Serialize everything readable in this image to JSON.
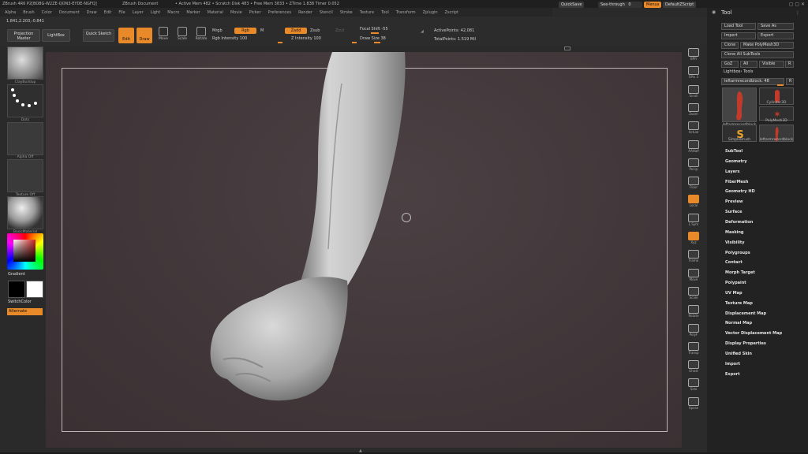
{
  "titlebar": {
    "app": "ZBrush 4R6 P2[BO8G-W2ZE-QON3-EYDE-NGFQ]",
    "document": "ZBrush Document",
    "stats": "• Active Mem 482 • Scratch Disk 483 • Free Mem 3833 • ZTime 1.838 Timer 0.052"
  },
  "menubar": [
    "Alpha",
    "Brush",
    "Color",
    "Document",
    "Draw",
    "Edit",
    "File",
    "Layer",
    "Light",
    "Macro",
    "Marker",
    "Material",
    "Movie",
    "Picker",
    "Preferences",
    "Render",
    "Stencil",
    "Stroke",
    "Texture",
    "Tool",
    "Transform",
    "Zplugin",
    "Zscript"
  ],
  "topright": {
    "quicksave": "QuickSave",
    "seethrough": "See-through",
    "seethrough_value": "0",
    "menus": "Menus",
    "defaultscript": "DefaultZScript"
  },
  "toolbar": {
    "coords": "1.841,2.203,-0.841",
    "projection_master": "Projection Master",
    "lightbox": "LightBox",
    "quick_sketch": "Quick Sketch",
    "edit": "Edit",
    "draw": "Draw",
    "move": "Move",
    "scale": "Scale",
    "rotate": "Rotate",
    "mrgb": "Mrgb",
    "rgb": "Rgb",
    "m": "M",
    "zadd": "Zadd",
    "zsub": "Zsub",
    "zcut": "Zcut",
    "rgb_intensity": "Rgb Intensity 100",
    "z_intensity": "Z Intensity 100",
    "focal_shift": "Focal Shift -55",
    "draw_size": "Draw Size 38",
    "active_points": "ActivePoints: 42,081",
    "total_points": "TotalPoints: 1.519 Mil"
  },
  "leftshelf": {
    "brush_label": "ClayBuildup",
    "stroke_label": "Dots",
    "alpha_label": "Alpha Off",
    "texture_label": "Texture Off",
    "material_label": "BasicMaterial",
    "gradient": "Gradient",
    "switch_color": "SwitchColor",
    "alternate": "Alternate"
  },
  "rightshelf": [
    "BPR",
    "SPix 3",
    "Scroll",
    "Zoom",
    "Actual",
    "AAHalf",
    "Persp",
    "Floor",
    "Local",
    "L.Sym",
    "Xyz",
    "Frame",
    "Move",
    "Scale",
    "Rotate",
    "PolyF",
    "Transp",
    "Ghost",
    "Solo",
    "Xpose"
  ],
  "palette": {
    "title": "Tool",
    "load_tool": "Load Tool",
    "save_as": "Save As",
    "import": "Import",
    "export": "Export",
    "clone": "Clone",
    "make_polymesh": "Make PolyMesh3D",
    "clone_all": "Clone All SubTools",
    "goz": "GoZ",
    "all": "All",
    "visible": "Visible",
    "r": "R",
    "lightbox_tools": "Lightbox› Tools",
    "current_tool": "leftarmrecordblock. 48",
    "tools": [
      "leftarmrecordblock",
      "Cylinder3D",
      "PolyMesh3D",
      "SimpleBrush",
      "leftarmrecordblock"
    ],
    "sections": [
      "SubTool",
      "Geometry",
      "Layers",
      "FiberMesh",
      "Geometry HD",
      "Preview",
      "Surface",
      "Deformation",
      "Masking",
      "Visibility",
      "Polygroups",
      "Contact",
      "Morph Target",
      "Polypaint",
      "UV Map",
      "Texture Map",
      "Displacement Map",
      "Normal Map",
      "Vector Displacement Map",
      "Display Properties",
      "Unified Skin",
      "Import",
      "Export"
    ]
  },
  "colors": {
    "accent": "#e8892a",
    "canvas": "#443a3c",
    "panel": "#2b2b2b"
  }
}
